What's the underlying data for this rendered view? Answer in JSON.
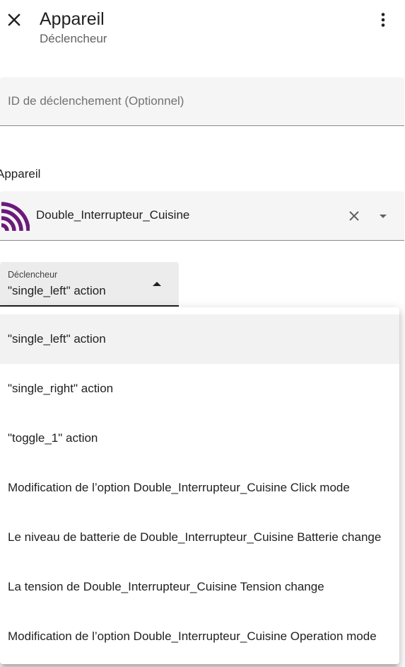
{
  "header": {
    "title": "Appareil",
    "subtitle": "Déclencheur",
    "close_icon": "close-icon",
    "overflow_icon": "more-vert-icon"
  },
  "trigger_id_field": {
    "placeholder": "ID de déclenchement (Optionnel)",
    "value": ""
  },
  "device": {
    "section_label": "Appareil",
    "selected_device": "Double_Interrupteur_Cuisine",
    "logo_icon": "zigbee-signal-icon",
    "logo_color": "#6a1b7a",
    "clear_icon": "clear-icon",
    "dropdown_icon": "arrow-drop-down-icon"
  },
  "trigger_select": {
    "label": "Déclencheur",
    "value": "\"single_left\" action",
    "arrow_icon": "arrow-drop-up-icon"
  },
  "dropdown": {
    "selected_index": 0,
    "options": [
      "\"single_left\" action",
      "\"single_right\" action",
      "\"toggle_1\" action",
      "Modification de l’option Double_Interrupteur_Cuisine Click mode",
      "Le niveau de batterie de Double_Interrupteur_Cuisine Batterie change",
      "La tension de Double_Interrupteur_Cuisine Tension change",
      "Modification de l’option Double_Interrupteur_Cuisine Operation mode"
    ]
  }
}
